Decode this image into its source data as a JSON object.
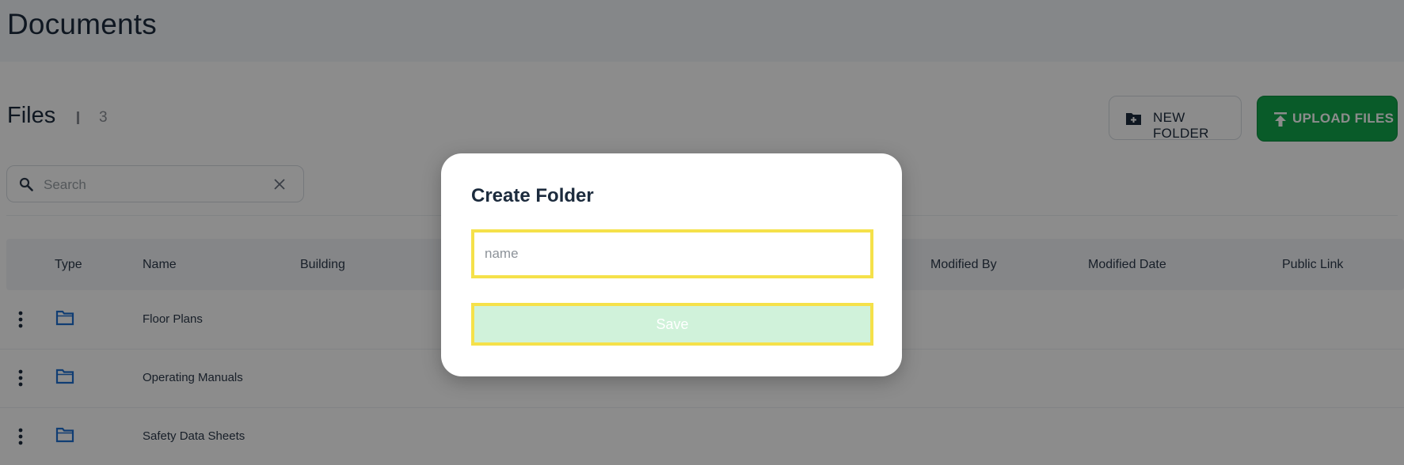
{
  "header": {
    "title": "Documents"
  },
  "files": {
    "title": "Files",
    "count": "3",
    "new_folder_label": "NEW FOLDER",
    "upload_label": "UPLOAD FILES"
  },
  "search": {
    "placeholder": "Search",
    "value": ""
  },
  "table": {
    "columns": {
      "type": "Type",
      "name": "Name",
      "building": "Building",
      "modified_by": "Modified By",
      "modified_date": "Modified Date",
      "public_link": "Public Link"
    },
    "rows": [
      {
        "name": "Floor Plans",
        "icon": "folder-icon"
      },
      {
        "name": "Operating Manuals",
        "icon": "folder-icon"
      },
      {
        "name": "Safety Data Sheets",
        "icon": "folder-icon"
      }
    ]
  },
  "modal": {
    "title": "Create Folder",
    "input_placeholder": "name",
    "input_value": "",
    "save_label": "Save"
  },
  "colors": {
    "primary_green": "#12a74c",
    "folder_blue": "#1e6fd1",
    "highlight_yellow": "#f5e14a",
    "save_disabled_bg": "#d0f2da"
  }
}
